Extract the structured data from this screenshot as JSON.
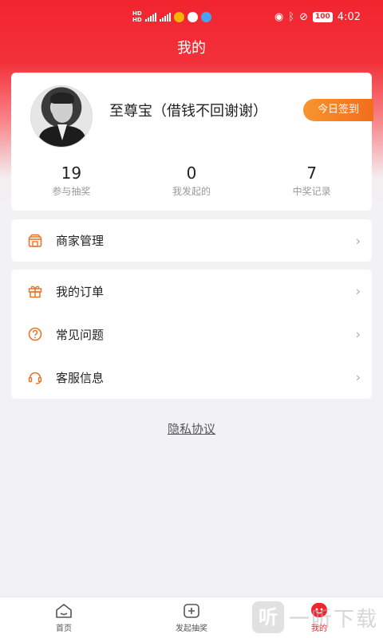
{
  "status_bar": {
    "network_1": "HD",
    "network_2": "HD",
    "time": "4:02",
    "battery": "100"
  },
  "header": {
    "title": "我的"
  },
  "profile": {
    "username": "至尊宝（借钱不回谢谢）",
    "checkin_label": "今日签到",
    "stats": [
      {
        "value": "19",
        "label": "参与抽奖"
      },
      {
        "value": "0",
        "label": "我发起的"
      },
      {
        "value": "7",
        "label": "中奖记录"
      }
    ]
  },
  "menu_group_1": [
    {
      "label": "商家管理",
      "icon": "store-icon"
    }
  ],
  "menu_group_2": [
    {
      "label": "我的订单",
      "icon": "gift-icon"
    },
    {
      "label": "常见问题",
      "icon": "question-icon"
    },
    {
      "label": "客服信息",
      "icon": "headset-icon"
    }
  ],
  "privacy_link": "隐私协议",
  "tabbar": {
    "tabs": [
      {
        "label": "首页",
        "icon": "home-icon"
      },
      {
        "label": "发起抽奖",
        "icon": "add-box-icon"
      },
      {
        "label": "我的",
        "icon": "profile-icon",
        "active": true
      }
    ]
  },
  "watermark": {
    "mark": "听",
    "text": "一听下载"
  },
  "colors": {
    "accent": "#f1242e",
    "checkin": "#f26d1c",
    "menu_icon": "#e8742a",
    "background": "#f2f2f4"
  }
}
